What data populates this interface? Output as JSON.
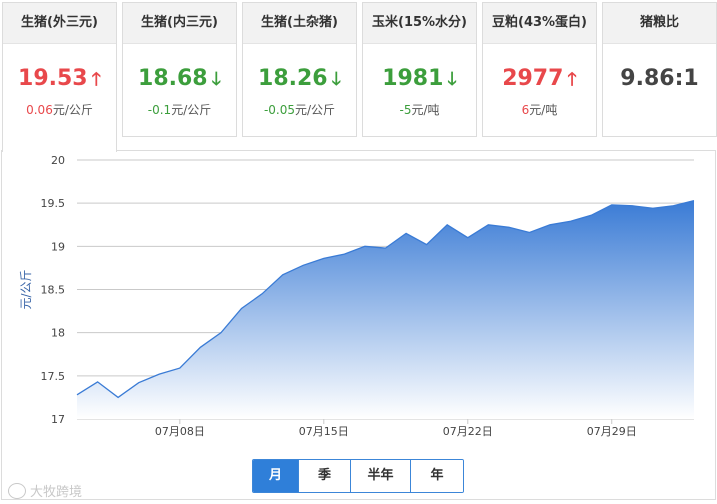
{
  "cards": [
    {
      "title": "生猪(外三元)",
      "value": "19.53",
      "trend": "up",
      "change": "0.06",
      "unit": "元/公斤"
    },
    {
      "title": "生猪(内三元)",
      "value": "18.68",
      "trend": "down",
      "change": "-0.1",
      "unit": "元/公斤"
    },
    {
      "title": "生猪(土杂猪)",
      "value": "18.26",
      "trend": "down",
      "change": "-0.05",
      "unit": "元/公斤"
    },
    {
      "title": "玉米(15%水分)",
      "value": "1981",
      "trend": "down",
      "change": "-5",
      "unit": "元/吨"
    },
    {
      "title": "豆粕(43%蛋白)",
      "value": "2977",
      "trend": "up",
      "change": "6",
      "unit": "元/吨"
    },
    {
      "title": "猪粮比",
      "value": "9.86:1",
      "trend": "none",
      "change": "",
      "unit": ""
    }
  ],
  "chart_data": {
    "type": "area",
    "ylabel": "元/公斤",
    "ylim": [
      17,
      20
    ],
    "yticks": [
      17,
      17.5,
      18,
      18.5,
      19,
      19.5,
      20
    ],
    "xticks": [
      {
        "label": "07月08日",
        "index": 5
      },
      {
        "label": "07月15日",
        "index": 12
      },
      {
        "label": "07月22日",
        "index": 19
      },
      {
        "label": "07月29日",
        "index": 26
      }
    ],
    "values": [
      17.28,
      17.43,
      17.25,
      17.42,
      17.52,
      17.59,
      17.83,
      18.0,
      18.28,
      18.45,
      18.67,
      18.78,
      18.86,
      18.91,
      19.0,
      18.98,
      19.15,
      19.02,
      19.25,
      19.1,
      19.25,
      19.22,
      19.16,
      19.25,
      19.29,
      19.36,
      19.48,
      19.47,
      19.44,
      19.47,
      19.53
    ],
    "grid": true,
    "line_color": "#3a7bd5",
    "fill_color_top": "#3a7bd5",
    "fill_color_bottom": "#ffffff"
  },
  "range_tabs": [
    "月",
    "季",
    "半年",
    "年"
  ],
  "range_selected": 0,
  "watermark": "大牧跨境",
  "colors": {
    "up": "#e8484b",
    "down": "#3c9e3c",
    "accent": "#2f7fd9"
  }
}
